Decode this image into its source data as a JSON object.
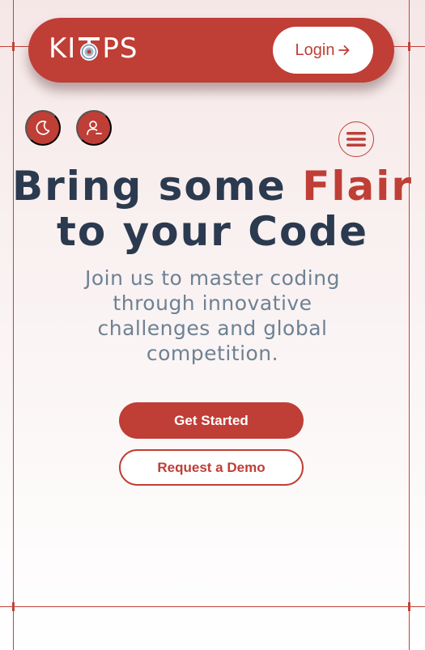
{
  "brand": {
    "logo_text_left": "KI",
    "logo_text_right": "PS",
    "primary_color": "#bf3e36",
    "dark_text_color": "#2b3a4f",
    "muted_text_color": "#6d8294"
  },
  "header": {
    "login_label": "Login",
    "login_icon": "arrow-right-icon"
  },
  "controls": {
    "theme_icon": "moon-icon",
    "profile_icon": "user-icon",
    "menu_icon": "hamburger-menu-icon"
  },
  "hero": {
    "title_part1": "Bring some ",
    "title_accent": "Flair",
    "title_part2": "to your Code",
    "subtitle": "Join us to master coding through innovative challenges and global competition.",
    "cta_primary": "Get Started",
    "cta_secondary": "Request a Demo"
  }
}
